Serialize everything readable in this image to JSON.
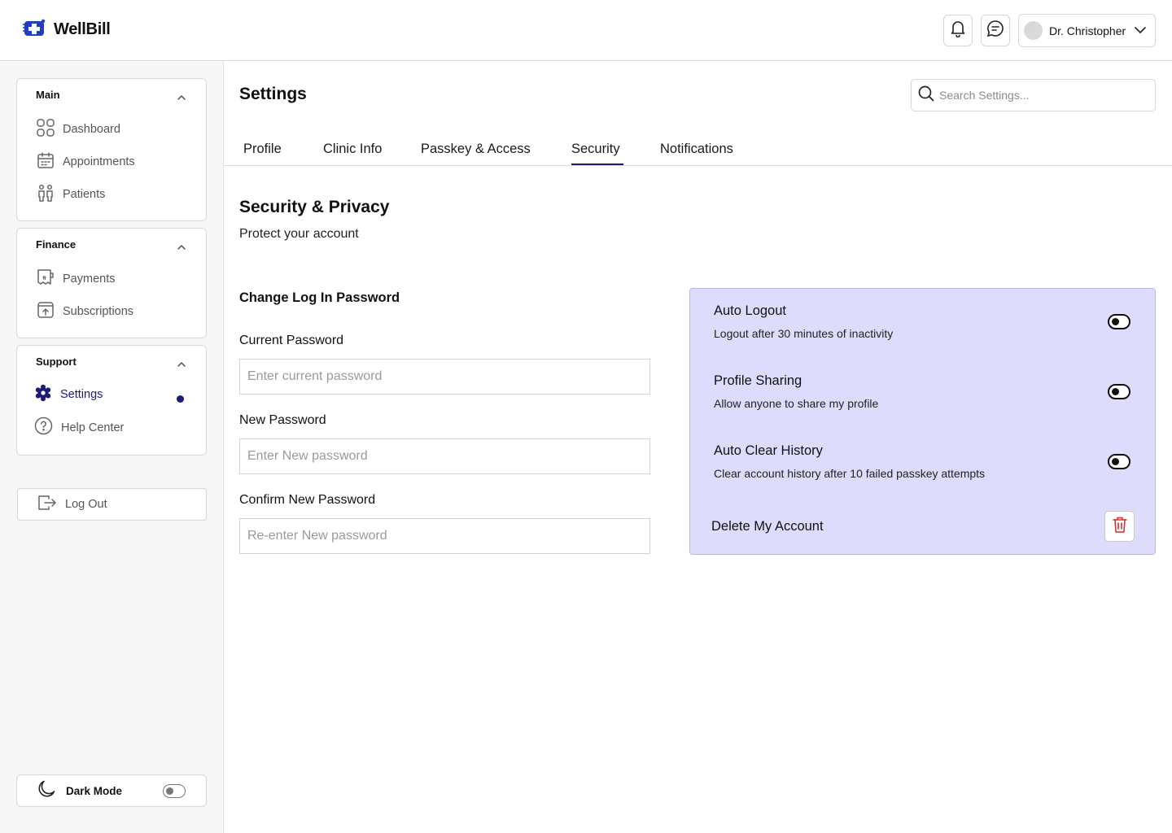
{
  "app": {
    "name": "WellBill"
  },
  "header": {
    "user_name": "Dr. Christopher"
  },
  "sidebar": {
    "groups": [
      {
        "title": "Main",
        "items": [
          {
            "label": "Dashboard"
          },
          {
            "label": "Appointments"
          },
          {
            "label": "Patients"
          }
        ]
      },
      {
        "title": "Finance",
        "items": [
          {
            "label": "Payments"
          },
          {
            "label": "Subscriptions"
          }
        ]
      },
      {
        "title": "Support",
        "items": [
          {
            "label": "Settings",
            "active": true
          },
          {
            "label": "Help Center"
          }
        ]
      }
    ],
    "logout_label": "Log Out",
    "dark_mode_label": "Dark Mode",
    "dark_mode_on": false
  },
  "main": {
    "title": "Settings",
    "search_placeholder": "Search Settings...",
    "tabs": [
      {
        "label": "Profile"
      },
      {
        "label": "Clinic Info"
      },
      {
        "label": "Passkey & Access"
      },
      {
        "label": "Security",
        "active": true
      },
      {
        "label": "Notifications"
      }
    ],
    "section_title": "Security & Privacy",
    "section_subtitle": "Protect your account",
    "form": {
      "title": "Change Log In Password",
      "fields": [
        {
          "label": "Current Password",
          "placeholder": "Enter current password"
        },
        {
          "label": "New Password",
          "placeholder": "Enter New password"
        },
        {
          "label": "Confirm New Password",
          "placeholder": "Re-enter New password"
        }
      ]
    },
    "security_options": [
      {
        "title": "Auto Logout",
        "description": "Logout after 30 minutes of inactivity",
        "enabled": false
      },
      {
        "title": "Profile Sharing",
        "description": "Allow anyone to share my profile",
        "enabled": false
      },
      {
        "title": "Auto Clear History",
        "description": "Clear account history after 10 failed passkey attempts",
        "enabled": false
      }
    ],
    "delete_label": "Delete My Account"
  },
  "colors": {
    "accent": "#1e1a78",
    "panel_bg": "#dedcfd",
    "danger": "#d32f2f"
  }
}
